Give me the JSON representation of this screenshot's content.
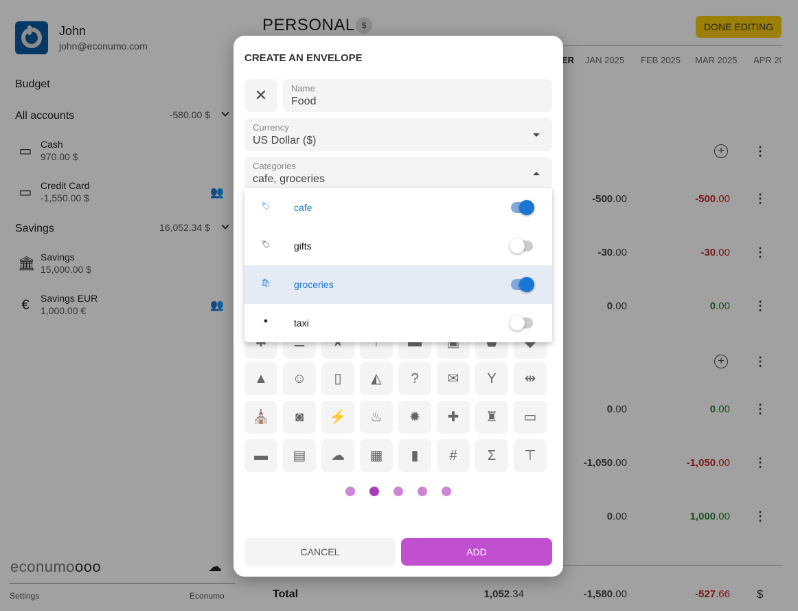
{
  "user": {
    "name": "John",
    "email": "john@econumo.com"
  },
  "sidebar": {
    "budget_label": "Budget",
    "groups": [
      {
        "label": "All accounts",
        "total": "-580.00 $",
        "accounts": [
          {
            "name": "Cash",
            "balance": "970.00 $",
            "icon": "wallet-icon",
            "shared": false
          },
          {
            "name": "Credit Card",
            "balance": "-1,550.00 $",
            "icon": "credit-card-icon",
            "shared": true
          }
        ]
      },
      {
        "label": "Savings",
        "total": "16,052.34 $",
        "accounts": [
          {
            "name": "Savings",
            "balance": "15,000.00 $",
            "icon": "bank-icon",
            "shared": false
          },
          {
            "name": "Savings EUR",
            "balance": "1,000.00 €",
            "icon": "euro-icon",
            "shared": true
          }
        ]
      }
    ],
    "logo": "econumo",
    "footer": {
      "settings": "Settings",
      "app": "Econumo"
    }
  },
  "main": {
    "title": "PERSONAL",
    "currency_badge": "$",
    "done_label": "DONE EDITING",
    "columns": [
      "ER",
      "JAN 2025",
      "FEB 2025",
      "MAR 2025",
      "APR 20"
    ],
    "rows": [
      {
        "type": "folder"
      },
      {
        "jan": [
          "-500",
          ".00"
        ],
        "mar": [
          "-500",
          ".00"
        ],
        "mar_color": "red"
      },
      {
        "jan": [
          "-30",
          ".00"
        ],
        "mar": [
          "-30",
          ".00"
        ],
        "mar_color": "red"
      },
      {
        "jan": [
          "0",
          ".00"
        ],
        "mar": [
          "0",
          ".00"
        ],
        "mar_color": "green"
      },
      {
        "type": "folder"
      },
      {
        "jan": [
          "0",
          ".00"
        ],
        "mar": [
          "0",
          ".00"
        ],
        "mar_color": "green"
      },
      {
        "jan": [
          "-1,050",
          ".00"
        ],
        "mar": [
          "-1,050",
          ".00"
        ],
        "mar_color": "red"
      },
      {
        "jan": [
          "0",
          ".00"
        ],
        "mar": [
          "1,000",
          ".00"
        ],
        "mar_color": "green"
      }
    ],
    "total": {
      "label": "Total",
      "budget": [
        "1,052",
        ".34"
      ],
      "jan": [
        "-1,580",
        ".00"
      ],
      "mar": [
        "-527",
        ".66"
      ],
      "currency": "$"
    }
  },
  "modal": {
    "title": "CREATE AN ENVELOPE",
    "icon": "fork-spoon-icon",
    "name": {
      "label": "Name",
      "value": "Food"
    },
    "currency": {
      "label": "Currency",
      "value": "US Dollar ($)"
    },
    "categories": {
      "label": "Categories",
      "value": "cafe, groceries",
      "options": [
        {
          "label": "cafe",
          "icon": "tag-icon",
          "selected": true
        },
        {
          "label": "gifts",
          "icon": "tag-icon",
          "selected": false
        },
        {
          "label": "groceries",
          "icon": "shopping-bag-icon",
          "selected": true,
          "highlighted": true
        },
        {
          "label": "taxi",
          "icon": "taxi-icon",
          "selected": false
        }
      ]
    },
    "icon_grid": [
      [
        "✱",
        "☰",
        "★",
        "↑",
        "▬",
        "▣",
        "⬟",
        "◆"
      ],
      [
        "▲",
        "☺",
        "▯",
        "◭",
        "?",
        "✉",
        "Y",
        "⇹"
      ],
      [
        "⛪",
        "◙",
        "⚡",
        "♨",
        "✹",
        "✚",
        "♜",
        "▭"
      ],
      [
        "▬",
        "▤",
        "☁",
        "▦",
        "▮",
        "#",
        "Σ",
        "⊤"
      ]
    ],
    "page_count": 5,
    "active_page": 2,
    "cancel_label": "CANCEL",
    "add_label": "ADD",
    "colors": {
      "accent": "#c050d0",
      "toggle_on": "#1976d2"
    }
  }
}
